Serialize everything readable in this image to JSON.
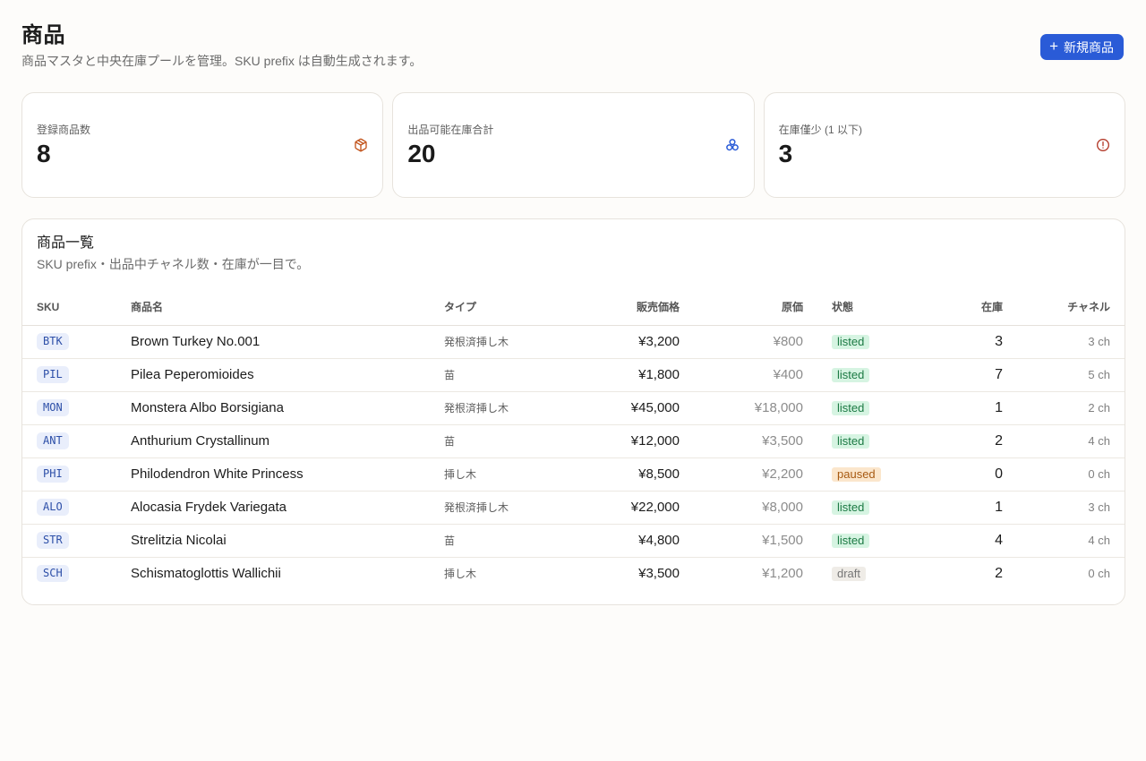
{
  "header": {
    "title": "商品",
    "subtitle": "商品マスタと中央在庫プールを管理。SKU prefix は自動生成されます。",
    "new_button_icon": "plus-icon",
    "new_button_label": "新規商品"
  },
  "stats": [
    {
      "label": "登録商品数",
      "value": "8",
      "icon": "package-icon",
      "color": "#c2531b"
    },
    {
      "label": "出品可能在庫合計",
      "value": "20",
      "icon": "layers-icon",
      "color": "#2a5bd7"
    },
    {
      "label": "在庫僅少 (1 以下)",
      "value": "3",
      "icon": "alert-circle-icon",
      "color": "#b33a2a"
    }
  ],
  "table": {
    "title": "商品一覧",
    "subtitle": "SKU prefix・出品中チャネル数・在庫が一目で。",
    "columns": [
      "SKU",
      "商品名",
      "タイプ",
      "販売価格",
      "原価",
      "状態",
      "在庫",
      "チャネル"
    ],
    "rows": [
      {
        "sku": "BTK",
        "name": "Brown Turkey No.001",
        "type": "発根済挿し木",
        "price": "¥3,200",
        "cost": "¥800",
        "status": "listed",
        "stock": "3",
        "channels": "3 ch"
      },
      {
        "sku": "PIL",
        "name": "Pilea Peperomioides",
        "type": "苗",
        "price": "¥1,800",
        "cost": "¥400",
        "status": "listed",
        "stock": "7",
        "channels": "5 ch"
      },
      {
        "sku": "MON",
        "name": "Monstera Albo Borsigiana",
        "type": "発根済挿し木",
        "price": "¥45,000",
        "cost": "¥18,000",
        "status": "listed",
        "stock": "1",
        "channels": "2 ch"
      },
      {
        "sku": "ANT",
        "name": "Anthurium Crystallinum",
        "type": "苗",
        "price": "¥12,000",
        "cost": "¥3,500",
        "status": "listed",
        "stock": "2",
        "channels": "4 ch"
      },
      {
        "sku": "PHI",
        "name": "Philodendron White Princess",
        "type": "挿し木",
        "price": "¥8,500",
        "cost": "¥2,200",
        "status": "paused",
        "stock": "0",
        "channels": "0 ch"
      },
      {
        "sku": "ALO",
        "name": "Alocasia Frydek Variegata",
        "type": "発根済挿し木",
        "price": "¥22,000",
        "cost": "¥8,000",
        "status": "listed",
        "stock": "1",
        "channels": "3 ch"
      },
      {
        "sku": "STR",
        "name": "Strelitzia Nicolai",
        "type": "苗",
        "price": "¥4,800",
        "cost": "¥1,500",
        "status": "listed",
        "stock": "4",
        "channels": "4 ch"
      },
      {
        "sku": "SCH",
        "name": "Schismatoglottis Wallichii",
        "type": "挿し木",
        "price": "¥3,500",
        "cost": "¥1,200",
        "status": "draft",
        "stock": "2",
        "channels": "0 ch"
      }
    ]
  }
}
